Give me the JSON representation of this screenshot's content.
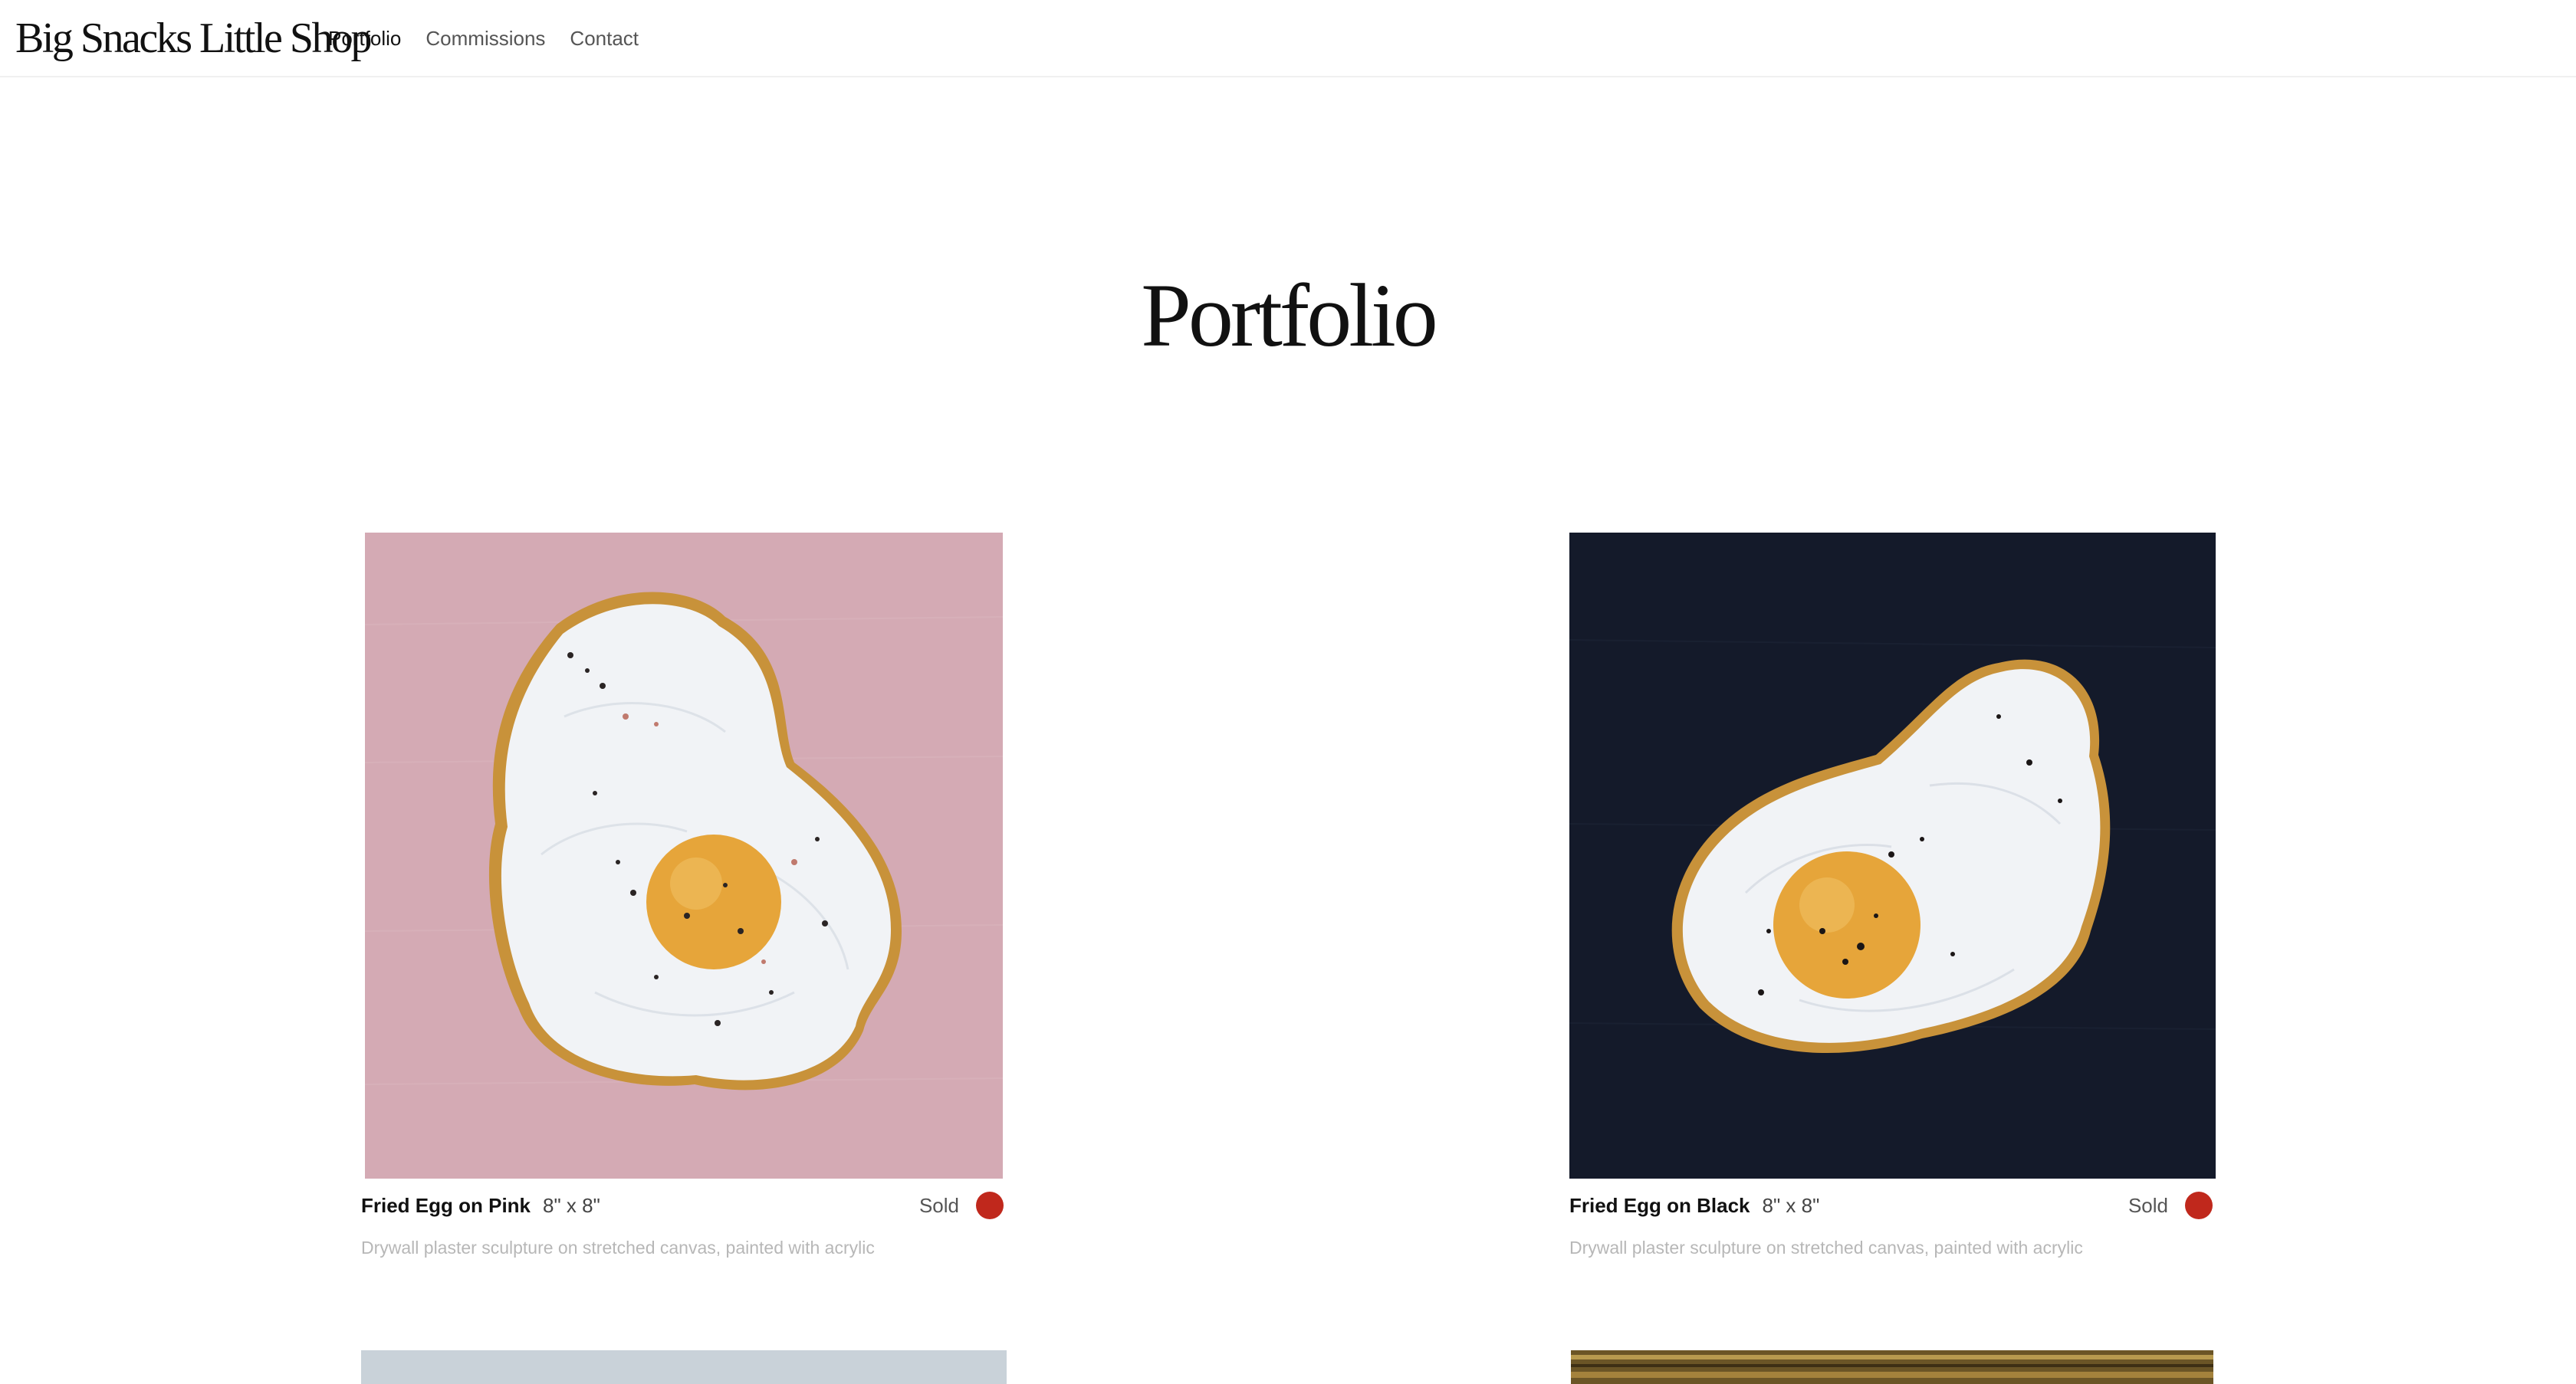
{
  "site": {
    "brand": "Big Snacks Little Shop"
  },
  "nav": {
    "items": [
      {
        "label": "Portfolio",
        "active": true
      },
      {
        "label": "Commissions",
        "active": false
      },
      {
        "label": "Contact",
        "active": false
      }
    ]
  },
  "page": {
    "title": "Portfolio"
  },
  "portfolio": {
    "items": [
      {
        "title": "Fried Egg on Pink",
        "size": "8\" x 8\"",
        "status": "Sold",
        "description": "Drywall plaster sculpture on stretched canvas, painted with acrylic",
        "background_color": "#d4aab4",
        "status_color": "#c0281c"
      },
      {
        "title": "Fried Egg on Black",
        "size": "8\" x 8\"",
        "status": "Sold",
        "description": "Drywall plaster sculpture on stretched canvas, painted with acrylic",
        "background_color": "#141a2a",
        "status_color": "#c0281c"
      }
    ]
  },
  "colors": {
    "egg_white": "#f1f3f6",
    "yolk": "#e6a53a",
    "crust": "#c8923a",
    "sold": "#c0281c"
  }
}
